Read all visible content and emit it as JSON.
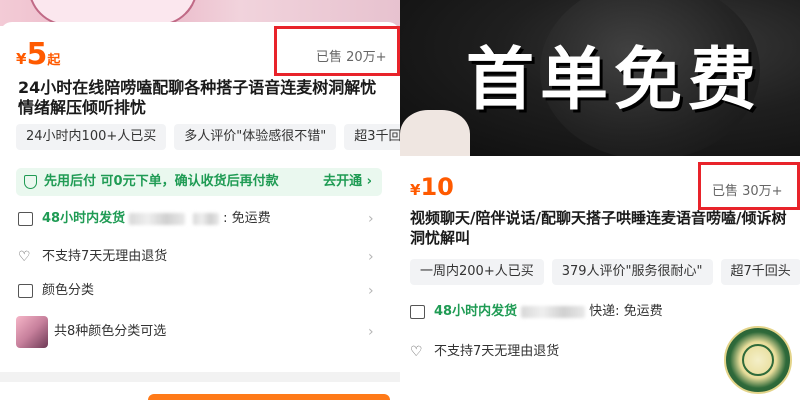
{
  "left": {
    "price": {
      "currency": "¥",
      "amount": "5",
      "unit": "起"
    },
    "sold": "已售 20万+",
    "title": "24小时在线陪唠嗑配聊各种搭子语音连麦树洞解忧情绪解压倾听排忧",
    "tags": [
      "24小时内100+人已买",
      "多人评价\"体验感很不错\"",
      "超3千回"
    ],
    "pay_later": {
      "text": "先用后付 可0元下单，确认收货后再付款",
      "action": "去开通 ›"
    },
    "shipping": {
      "time": "48小时内发货",
      "fee": ": 免运费"
    },
    "return_policy": "不支持7天无理由退货",
    "color_label": "颜色分类",
    "variants_text": "共8种颜色分类可选"
  },
  "right": {
    "banner_text": "首单免费",
    "price": {
      "currency": "¥",
      "amount": "10"
    },
    "sold": "已售 30万+",
    "title": "视频聊天/陪伴说话/配聊天搭子哄睡连麦语音唠嗑/倾诉树洞忧解叫",
    "tags": [
      "一周内200+人已买",
      "379人评价\"服务很耐心\"",
      "超7千回头"
    ],
    "shipping": {
      "time": "48小时内发货",
      "fee": "快递: 免运费"
    },
    "return_policy": "不支持7天无理由退货"
  },
  "colors": {
    "price": "#ff5a00",
    "highlight": "#e8232a",
    "green": "#1f9b54"
  }
}
